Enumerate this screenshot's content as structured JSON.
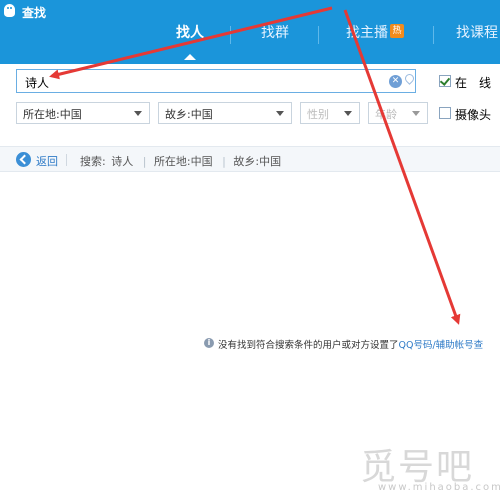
{
  "window": {
    "title": "查找"
  },
  "tabs": [
    {
      "label": "找人",
      "active": true
    },
    {
      "label": "找群",
      "active": false
    },
    {
      "label": "找主播",
      "active": false,
      "badge": "热"
    },
    {
      "label": "找课程",
      "active": false
    }
  ],
  "search": {
    "value": "诗人"
  },
  "filters": {
    "online": {
      "label": "在　线",
      "checked": true
    },
    "location": "所在地:中国",
    "hometown": "故乡:中国",
    "gender": "性别",
    "age": "年龄",
    "camera": {
      "label": "摄像头",
      "checked": false
    }
  },
  "back_bar": {
    "back_label": "返回",
    "search_prefix": "搜索:",
    "crumbs": [
      "诗人",
      "所在地:中国",
      "故乡:中国"
    ]
  },
  "message": {
    "text": "没有找到符合搜索条件的用户或对方设置了",
    "link": "QQ号码/辅助帐号查"
  },
  "watermark": {
    "main": "觅号吧",
    "url": "www.mihaoba.com"
  },
  "colors": {
    "header": "#1b95da",
    "arrow": "#e53935",
    "link": "#2f7bc7"
  }
}
